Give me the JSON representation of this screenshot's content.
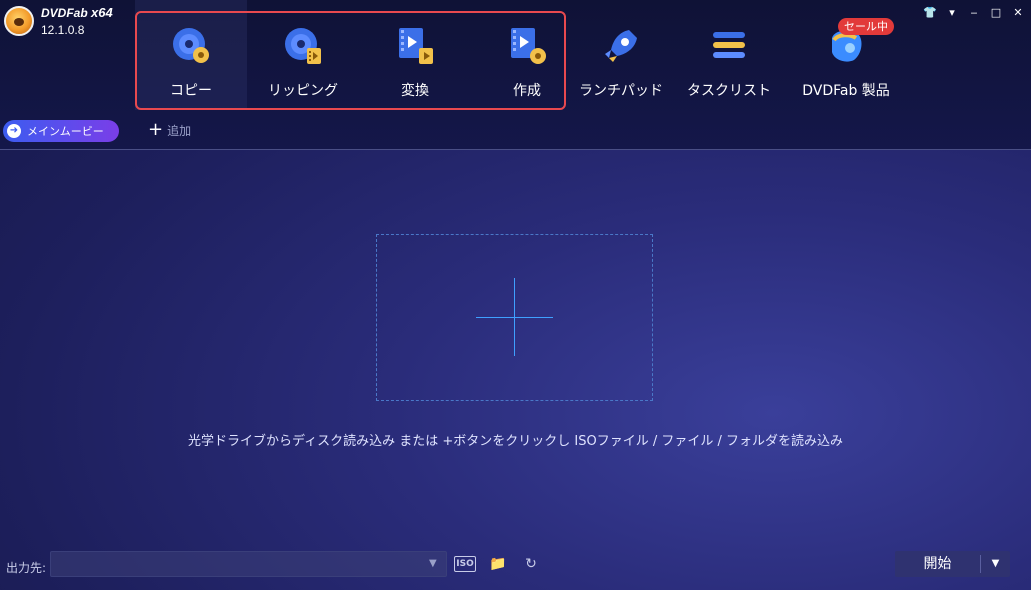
{
  "app": {
    "name": "DVDFab",
    "arch": "x64",
    "version": "12.1.0.8"
  },
  "modules": [
    {
      "id": "copy",
      "label": "コピー",
      "icon": "disc-copy-icon",
      "active": true
    },
    {
      "id": "ripper",
      "label": "リッピング",
      "icon": "disc-rip-icon",
      "active": false
    },
    {
      "id": "converter",
      "label": "変換",
      "icon": "film-convert-icon",
      "active": false
    },
    {
      "id": "creator",
      "label": "作成",
      "icon": "film-create-icon",
      "active": false
    }
  ],
  "tools": [
    {
      "id": "launchpad",
      "label": "ランチパッド",
      "icon": "rocket-icon"
    },
    {
      "id": "tasklist",
      "label": "タスクリスト",
      "icon": "task-list-icon"
    },
    {
      "id": "products",
      "label": "DVDFab 製品",
      "icon": "products-icon"
    }
  ],
  "sale_badge": "セール中",
  "subbar": {
    "main_copy_label": "メインムービー",
    "add_label": "追加"
  },
  "drop_hint": "光学ドライブからディスク読み込み または +ボタンをクリックし ISOファイル / ファイル / フォルダを読み込み",
  "output": {
    "label": "出力先:",
    "value": "",
    "iso_label": "ISO"
  },
  "start_label": "開始",
  "colors": {
    "highlight": "#e8494f",
    "accent": "#3fa0ff",
    "sale": "#e23a3a"
  }
}
